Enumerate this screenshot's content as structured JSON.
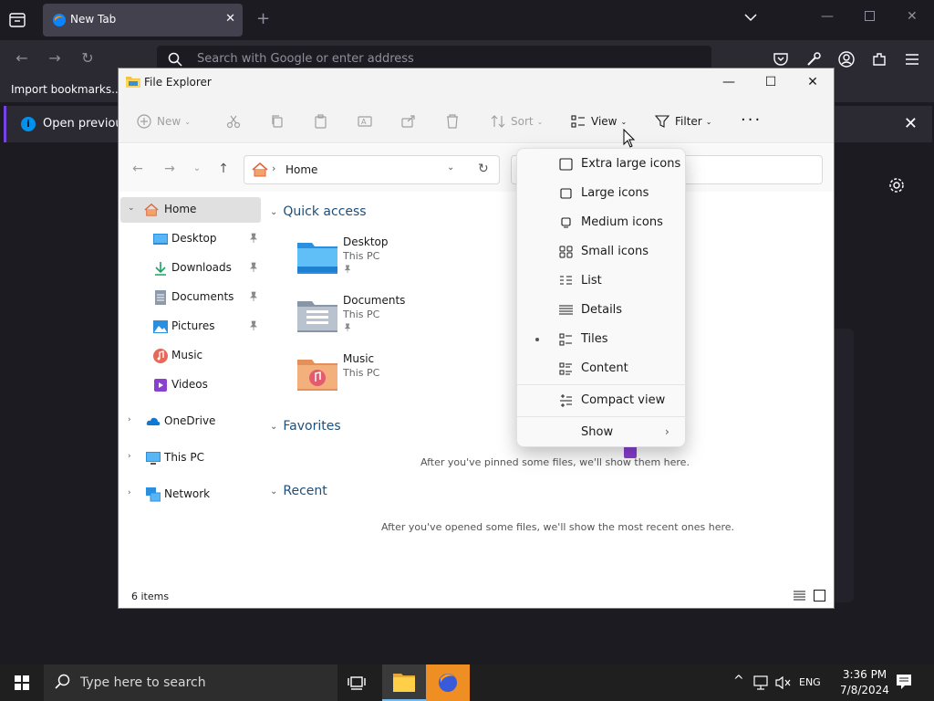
{
  "firefox": {
    "tab_title": "New Tab",
    "url_placeholder": "Search with Google or enter address",
    "bookmark_import": "Import bookmarks...",
    "notification": "Open previous t",
    "accent": "#7542e5"
  },
  "explorer": {
    "title": "File Explorer",
    "toolbar": {
      "new_label": "New",
      "sort_label": "Sort",
      "view_label": "View",
      "filter_label": "Filter"
    },
    "address": {
      "path": "Home"
    },
    "nav": {
      "home": "Home",
      "desktop": "Desktop",
      "downloads": "Downloads",
      "documents": "Documents",
      "pictures": "Pictures",
      "music": "Music",
      "videos": "Videos",
      "onedrive": "OneDrive",
      "thispc": "This PC",
      "network": "Network"
    },
    "sections": {
      "quick_access": "Quick access",
      "favorites": "Favorites",
      "recent": "Recent"
    },
    "quick_access_items": [
      {
        "name": "Desktop",
        "location": "This PC"
      },
      {
        "name": "Documents",
        "location": "This PC"
      },
      {
        "name": "Music",
        "location": "This PC"
      }
    ],
    "favorites_empty": "After you've pinned some files, we'll show them here.",
    "recent_empty": "After you've opened some files, we'll show the most recent ones here.",
    "status_count": "6 items"
  },
  "view_menu": {
    "items": [
      {
        "label": "Extra large icons"
      },
      {
        "label": "Large icons"
      },
      {
        "label": "Medium icons"
      },
      {
        "label": "Small icons"
      },
      {
        "label": "List"
      },
      {
        "label": "Details"
      },
      {
        "label": "Tiles",
        "selected": true
      },
      {
        "label": "Content"
      },
      {
        "label": "Compact view"
      },
      {
        "label": "Show"
      }
    ]
  },
  "taskbar": {
    "search_placeholder": "Type here to search",
    "language": "ENG",
    "time": "3:36 PM",
    "date": "7/8/2024"
  }
}
